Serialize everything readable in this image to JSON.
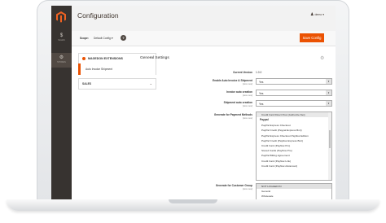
{
  "sidebar": {
    "items": [
      {
        "icon": "dollar-icon",
        "glyph": "$",
        "label": "SALES"
      },
      {
        "icon": "gear-icon",
        "glyph": "⚙",
        "label": "STORES"
      }
    ]
  },
  "header": {
    "title": "Configuration",
    "user": "demo"
  },
  "toolbar": {
    "scope_label": "Scope:",
    "scope_value": "Default Config",
    "help": "?",
    "save_label": "Save Config"
  },
  "tabs": {
    "group_title": "MAGEDON EXTENSIONS",
    "active_item": "Auto Invoice Shipment",
    "sales_title": "SALES"
  },
  "section": {
    "title": "General Settings"
  },
  "fields": {
    "current_version": {
      "label": "Current Version",
      "value": "1.0.0"
    },
    "enable": {
      "label": "Enable Auto Invoice & Shipment",
      "scope": "[store view]",
      "value": "Yes"
    },
    "invoice": {
      "label": "Invoice auto creation",
      "scope": "[store view]",
      "value": "Yes"
    },
    "shipment": {
      "label": "Shipment auto creation",
      "scope": "[store view]",
      "value": "Yes"
    },
    "payment": {
      "label": "Generate for Payment Methods",
      "scope": "[store view]",
      "options_top": [
        "Credit Card Direct Post (Authorize.Net)"
      ],
      "group": "Paypal",
      "options": [
        "PayPal Express Checkout",
        "PayPal Credit (Paypal Express Bml)",
        "PayPal Express Checkout Payflow Edition",
        "PayPal Credit (Payflow Express Bml)",
        "Credit Card (Payflow Pro)",
        "Stored Cards (Payflow Pro)",
        "PayPal Billing Agreement",
        "Credit Card (Payflow Link)",
        "Credit Card (Payflow Advanced)"
      ]
    },
    "customer_group": {
      "label": "Generate for Customer Group",
      "scope": "[store view]",
      "options": [
        "NOT LOGGED IN",
        "General",
        "Wholesale"
      ]
    }
  }
}
